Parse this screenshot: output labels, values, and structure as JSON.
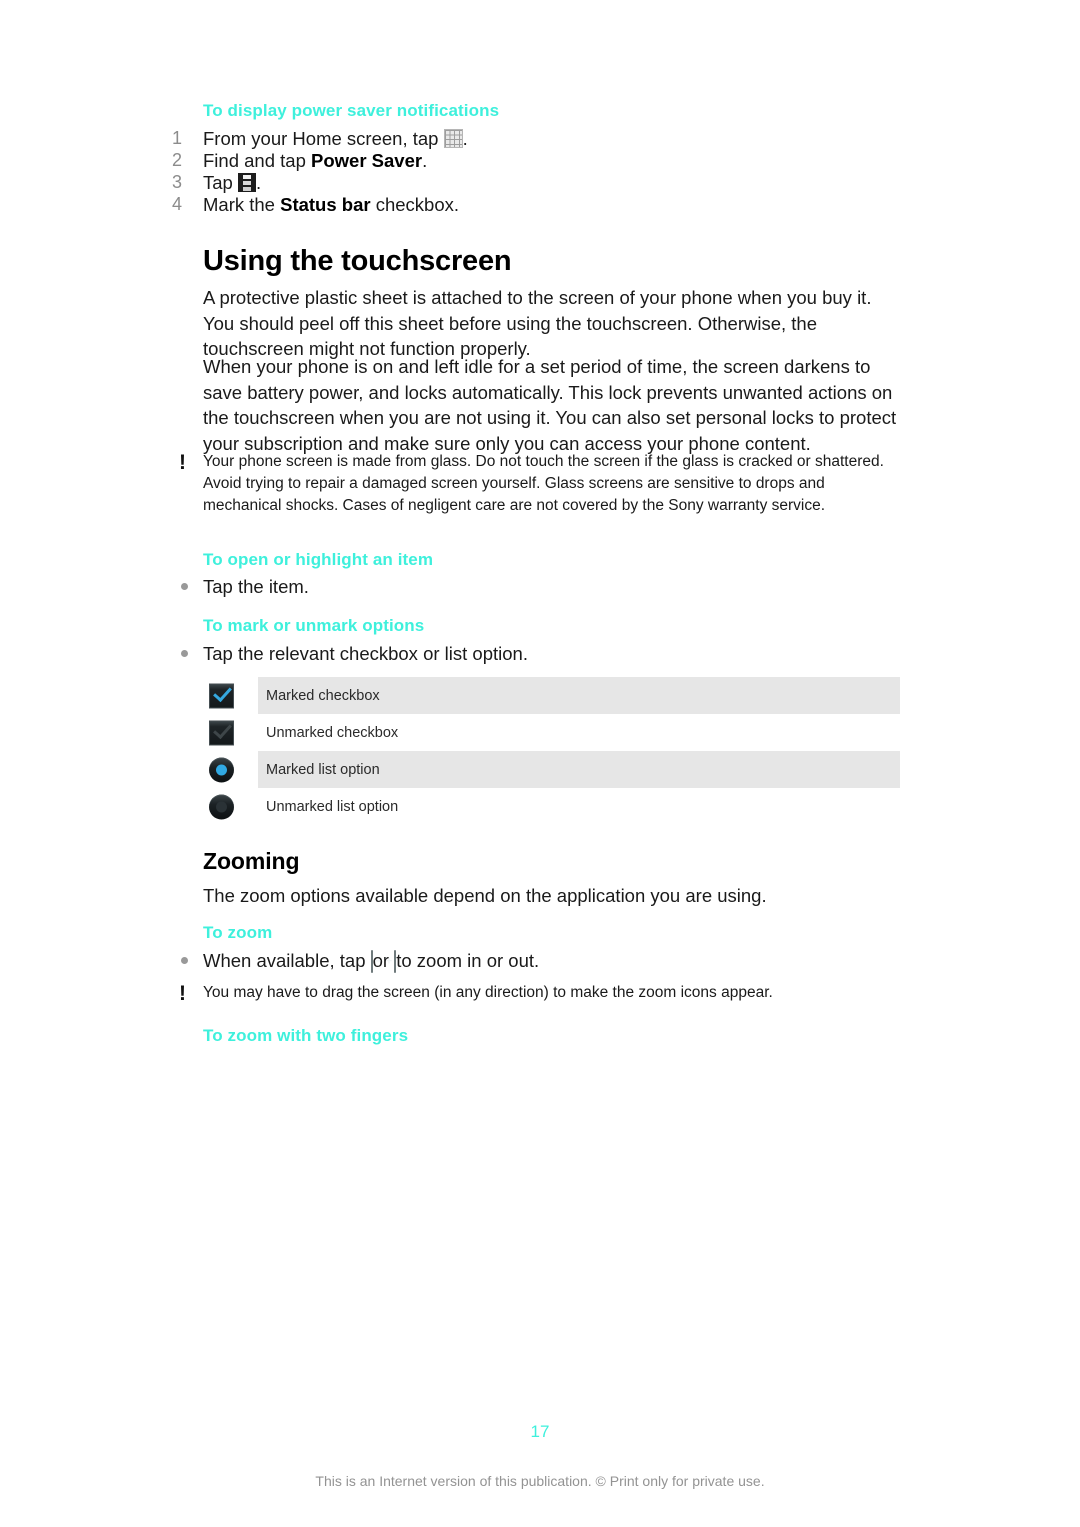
{
  "document": {
    "page_number": "17",
    "footer": "This is an Internet version of this publication. © Print only for private use."
  },
  "sections": {
    "power_saver": {
      "heading": "To display power saver notifications",
      "steps": [
        {
          "num": "1",
          "text_before": "From your Home screen, tap ",
          "icon": "app-grid-icon",
          "text_after": "."
        },
        {
          "num": "2",
          "text_before": "Find and tap ",
          "bold": "Power Saver",
          "text_after": "."
        },
        {
          "num": "3",
          "text_before": "Tap ",
          "icon": "overflow-menu-icon",
          "text_after": "."
        },
        {
          "num": "4",
          "text_before": "Mark the ",
          "bold": "Status bar",
          "text_after": " checkbox."
        }
      ]
    },
    "touchscreen": {
      "heading": "Using the touchscreen",
      "paragraph_1": "A protective plastic sheet is attached to the screen of your phone when you buy it. You should peel off this sheet before using the touchscreen. Otherwise, the touchscreen might not function properly.",
      "paragraph_2": "When your phone is on and left idle for a set period of time, the screen darkens to save battery power, and locks automatically. This lock prevents unwanted actions on the touchscreen when you are not using it. You can also set personal locks to protect your subscription and make sure only you can access your phone content.",
      "warning": "Your phone screen is made from glass. Do not touch the screen if the glass is cracked or shattered. Avoid trying to repair a damaged screen yourself. Glass screens are sensitive to drops and mechanical shocks. Cases of negligent care are not covered by the Sony warranty service.",
      "open_item": {
        "heading": "To open or highlight an item",
        "bullet": "Tap the item."
      },
      "mark_options": {
        "heading": "To mark or unmark options",
        "bullet": "Tap the relevant checkbox or list option."
      },
      "option_table": [
        {
          "icon": "marked-checkbox-icon",
          "label": "Marked checkbox",
          "shaded": true
        },
        {
          "icon": "unmarked-checkbox-icon",
          "label": "Unmarked checkbox",
          "shaded": false
        },
        {
          "icon": "marked-list-option-icon",
          "label": "Marked list option",
          "shaded": true
        },
        {
          "icon": "unmarked-list-option-icon",
          "label": "Unmarked list option",
          "shaded": false
        }
      ]
    },
    "zooming": {
      "heading": "Zooming",
      "paragraph": "The zoom options available depend on the application you are using.",
      "to_zoom": {
        "heading": "To zoom",
        "bullet_before": "When available, tap ",
        "icon_out": "zoom-out-icon",
        "bullet_middle": " or ",
        "icon_in": "zoom-in-icon",
        "bullet_after": " to zoom in or out."
      },
      "note": "You may have to drag the screen (in any direction) to make the zoom icons appear.",
      "two_fingers": {
        "heading": "To zoom with two fingers"
      }
    }
  },
  "colors": {
    "accent_teal": "#3ef0dc",
    "table_shade": "#e6e6e6",
    "icon_blue": "#35a8e0"
  },
  "icon_glyphs": {
    "zoom_out_sign": "−",
    "zoom_in_sign": "+",
    "warning_bang": "!"
  }
}
